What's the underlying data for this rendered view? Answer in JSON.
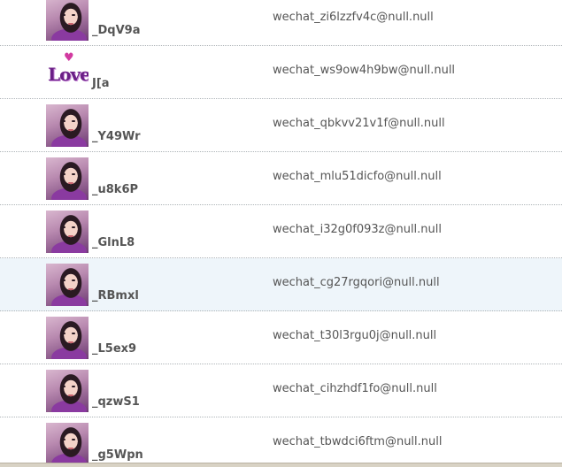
{
  "contacts": [
    {
      "name": "_DqV9a",
      "email": "wechat_zi6lzzfv4c@null.null",
      "avatar": "photo"
    },
    {
      "name": "J[a",
      "email": "wechat_ws9ow4h9bw@null.null",
      "avatar": "love",
      "avatar_text": "Love",
      "avatar_heart": "♥"
    },
    {
      "name": "_Y49Wr",
      "email": "wechat_qbkvv21v1f@null.null",
      "avatar": "photo"
    },
    {
      "name": "_u8k6P",
      "email": "wechat_mlu51dicfo@null.null",
      "avatar": "photo"
    },
    {
      "name": "_GlnL8",
      "email": "wechat_i32g0f093z@null.null",
      "avatar": "photo"
    },
    {
      "name": "_RBmxl",
      "email": "wechat_cg27rgqori@null.null",
      "avatar": "photo",
      "highlighted": true
    },
    {
      "name": "_L5ex9",
      "email": "wechat_t30l3rgu0j@null.null",
      "avatar": "photo"
    },
    {
      "name": "_qzwS1",
      "email": "wechat_cihzhdf1fo@null.null",
      "avatar": "photo"
    },
    {
      "name": "_g5Wpn",
      "email": "wechat_tbwdci6ftm@null.null",
      "avatar": "photo"
    }
  ],
  "colors": {
    "header_bg": "#eaf3f8",
    "row_highlight_bg": "#eef5fa",
    "text": "#555555"
  }
}
